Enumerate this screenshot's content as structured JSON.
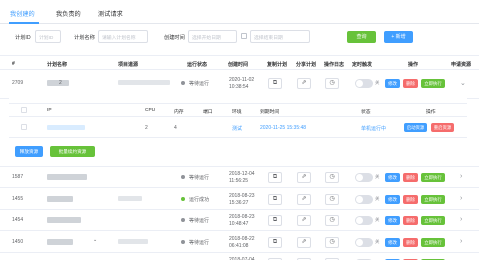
{
  "tabs": [
    "我创建的",
    "我负责的",
    "测试请求"
  ],
  "filters": {
    "id_label": "计划ID",
    "id_placeholder": "计划ID",
    "name_label": "计划名称",
    "name_placeholder": "请输入计划名称",
    "time_label": "创建时间",
    "start_placeholder": "选择开始日期",
    "end_placeholder": "选择结束日期",
    "query_label": "查询",
    "add_label": "+ 新增"
  },
  "columns": [
    "#",
    "计划名称",
    "项目道源",
    "运行状态",
    "创建时间",
    "复制计划",
    "分享计划",
    "操作日志",
    "定时触发",
    "操作",
    "申请资源"
  ],
  "main_rows": [
    {
      "id": "2709",
      "status": "等待运行",
      "status_color": "#909399",
      "date": "2020-11-02",
      "time": "10:38:54"
    },
    {
      "id": "1587",
      "status": "等待运行",
      "status_color": "#909399",
      "date": "2018-12-04",
      "time": "11:56:25"
    },
    {
      "id": "1455",
      "status": "运行成功",
      "status_color": "#67c23a",
      "date": "2018-08-23",
      "time": "15:36:27"
    },
    {
      "id": "1454",
      "status": "等待运行",
      "status_color": "#909399",
      "date": "2018-08-23",
      "time": "10:48:47"
    },
    {
      "id": "1450",
      "status": "等待运行",
      "status_color": "#909399",
      "date": "2018-08-22",
      "time": "06:41:08"
    },
    {
      "id": "",
      "status": "",
      "status_color": "#909399",
      "date": "2018-07-04",
      "time": ""
    }
  ],
  "switch_off": "关",
  "actions": {
    "edit": "修改",
    "delete": "删除",
    "run": "立即执行"
  },
  "icons": {
    "copy": "copy-icon",
    "share": "share-icon",
    "log": "clock-icon",
    "help": "question-icon"
  },
  "panel": {
    "columns": [
      "IP",
      "CPU",
      "内存",
      "端口",
      "环境",
      "到期时间",
      "状态",
      "操作"
    ],
    "row": {
      "cpu": "2",
      "mem": "4",
      "env": "测试",
      "expire": "2020-11-25 15:35:48",
      "state": "单机运行中",
      "start_btn": "启动资源",
      "release_btn": "重启资源"
    },
    "renew_btn": "释放资源",
    "apply_btn": "批量续约资源"
  }
}
